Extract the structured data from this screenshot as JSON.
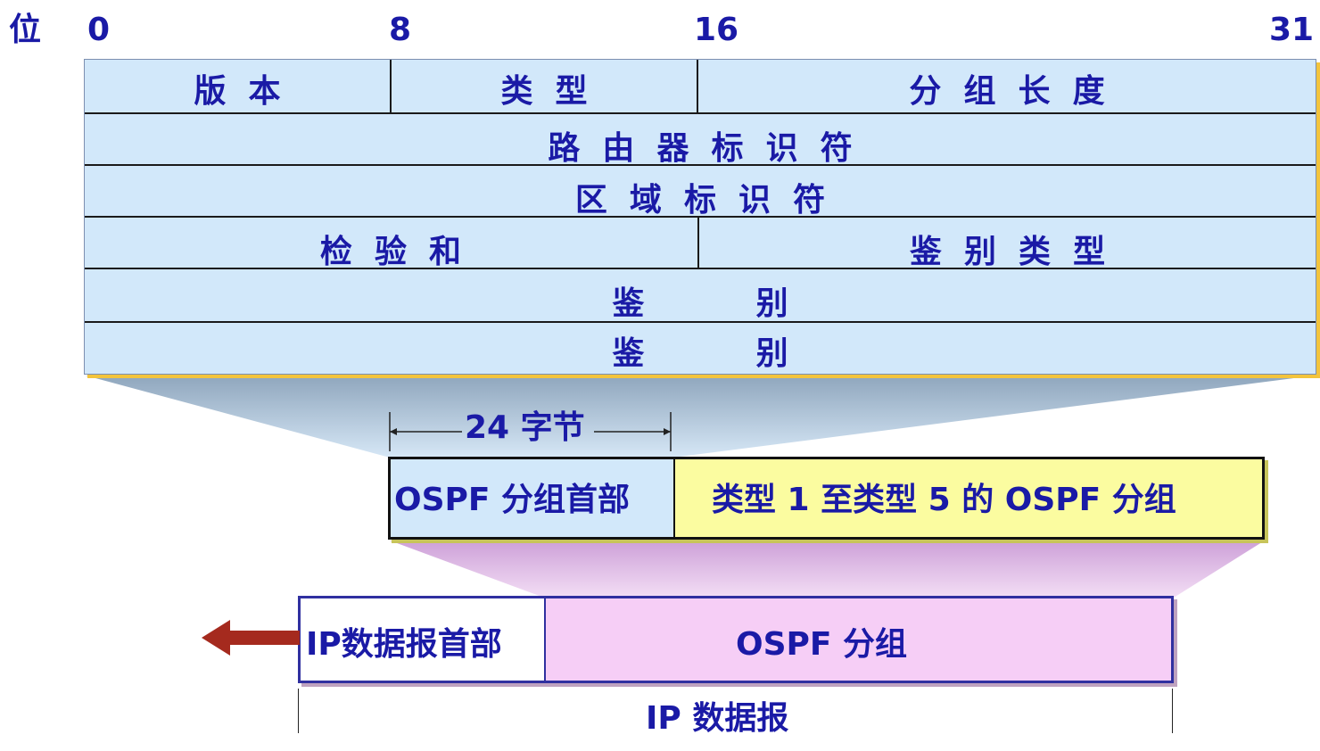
{
  "bit_ruler": {
    "label": "位",
    "marks": [
      "0",
      "8",
      "16",
      "31"
    ]
  },
  "header_rows": {
    "version": "版  本",
    "type": "类  型",
    "packet_length": "分  组  长  度",
    "router_id": "路  由  器  标  识  符",
    "area_id": "区  域  标  识  符",
    "checksum": "检  验  和",
    "auth_type": "鉴  别  类  型",
    "auth_1": "鉴          别",
    "auth_2": "鉴          别"
  },
  "size_label": "24 字节",
  "ospf_packet": {
    "header_label": "OSPF 分组首部",
    "body_label": "类型 1 至类型 5 的 OSPF 分组"
  },
  "ip_datagram": {
    "header_label": "IP数据报首部",
    "body_label": "OSPF 分组",
    "span_label": "IP 数据报"
  },
  "colors": {
    "text": "#1a1aa6",
    "header_fill": "#d2e8fa",
    "ospf_body_fill": "#fbfca0",
    "ip_body_fill": "#f6cef6",
    "arrow": "#a52a1e"
  }
}
